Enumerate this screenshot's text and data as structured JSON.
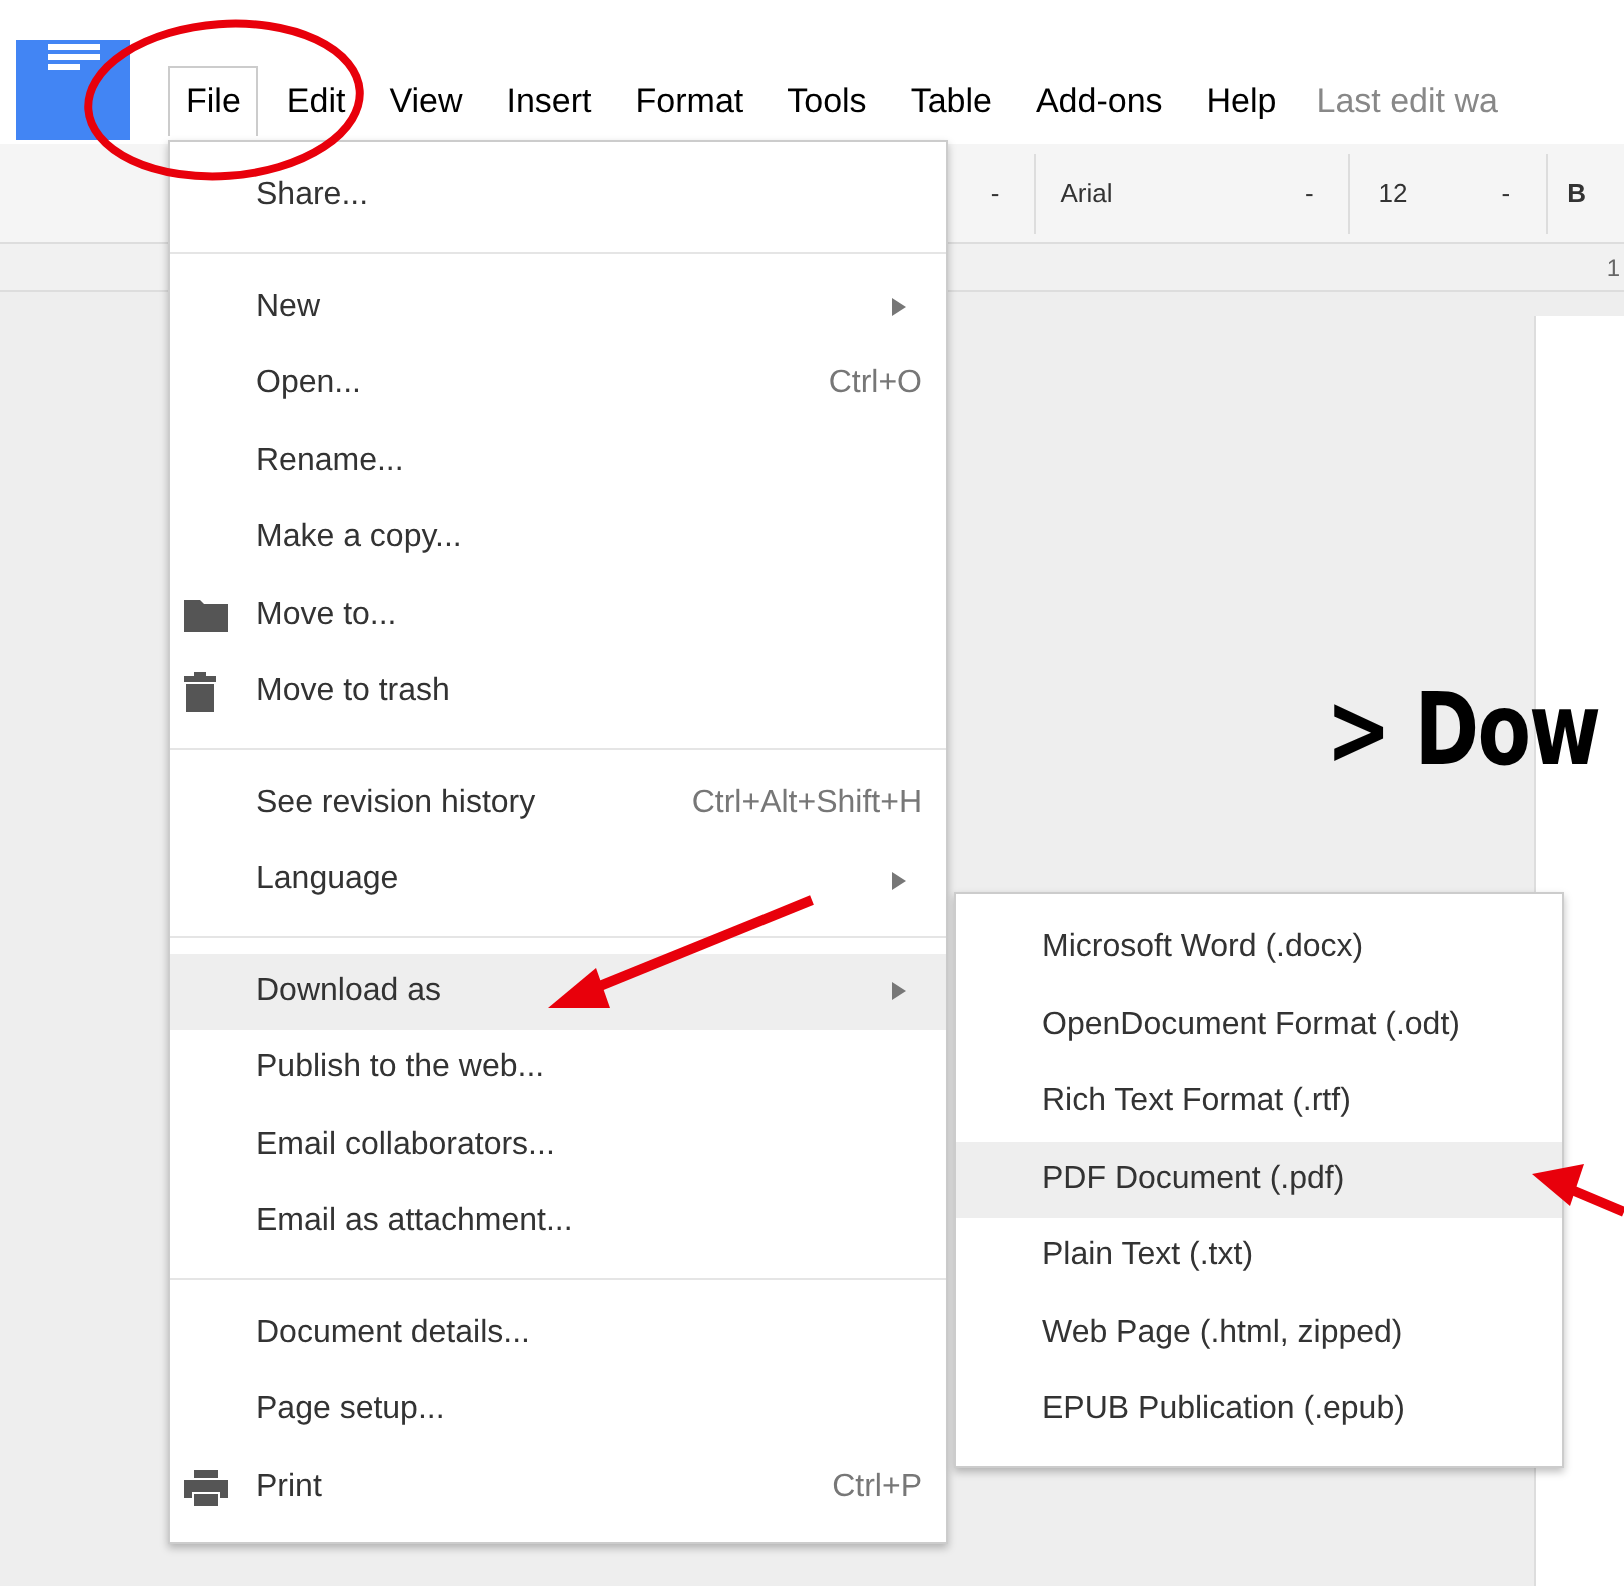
{
  "menubar": [
    {
      "label": "File",
      "selected": true
    },
    {
      "label": "Edit",
      "selected": false
    },
    {
      "label": "View",
      "selected": false
    },
    {
      "label": "Insert",
      "selected": false
    },
    {
      "label": "Format",
      "selected": false
    },
    {
      "label": "Tools",
      "selected": false
    },
    {
      "label": "Table",
      "selected": false
    },
    {
      "label": "Add-ons",
      "selected": false
    },
    {
      "label": "Help",
      "selected": false
    }
  ],
  "last_edit": "Last edit wa",
  "toolbar": [
    {
      "kind": "dropdown",
      "text": "-"
    },
    {
      "kind": "font",
      "text": "Arial"
    },
    {
      "kind": "dropdown",
      "text": "-"
    },
    {
      "kind": "size",
      "text": "12"
    },
    {
      "kind": "dropdown",
      "text": "-"
    },
    {
      "kind": "bold",
      "text": "B"
    }
  ],
  "ruler": "1",
  "file_menu": {
    "sections": [
      [
        {
          "kind": "plain",
          "label": "Share...",
          "selected": false
        }
      ],
      [
        {
          "kind": "plain",
          "label": "New",
          "has_submenu": true,
          "selected": false
        },
        {
          "kind": "plain",
          "label": "Open...",
          "shortcut": "Ctrl+O",
          "selected": false
        },
        {
          "kind": "plain",
          "label": "Rename...",
          "selected": false
        },
        {
          "kind": "plain",
          "label": "Make a copy...",
          "selected": false
        },
        {
          "kind": "folder",
          "label": "Move to...",
          "selected": false
        },
        {
          "kind": "trash",
          "label": "Move to trash",
          "selected": false
        }
      ],
      [
        {
          "kind": "plain",
          "label": "See revision history",
          "shortcut": "Ctrl+Alt+Shift+H",
          "selected": false
        },
        {
          "kind": "plain",
          "label": "Language",
          "has_submenu": true,
          "selected": false
        }
      ],
      [
        {
          "kind": "plain",
          "label": "Download as",
          "has_submenu": true,
          "selected": true
        },
        {
          "kind": "plain",
          "label": "Publish to the web...",
          "selected": false
        },
        {
          "kind": "plain",
          "label": "Email collaborators...",
          "selected": false
        },
        {
          "kind": "plain",
          "label": "Email as attachment...",
          "selected": false
        }
      ],
      [
        {
          "kind": "plain",
          "label": "Document details...",
          "selected": false
        },
        {
          "kind": "plain",
          "label": "Page setup...",
          "selected": false
        },
        {
          "kind": "printer",
          "label": "Print",
          "shortcut": "Ctrl+P",
          "selected": false
        }
      ]
    ]
  },
  "download_submenu": [
    {
      "label": "Microsoft Word (.docx)",
      "selected": false
    },
    {
      "label": "OpenDocument Format (.odt)",
      "selected": false
    },
    {
      "label": "Rich Text Format (.rtf)",
      "selected": false
    },
    {
      "label": "PDF Document (.pdf)",
      "selected": true
    },
    {
      "label": "Plain Text (.txt)",
      "selected": false
    },
    {
      "label": "Web Page (.html, zipped)",
      "selected": false
    },
    {
      "label": "EPUB Publication (.epub)",
      "selected": false
    }
  ],
  "overlay_heading": "> Dow"
}
